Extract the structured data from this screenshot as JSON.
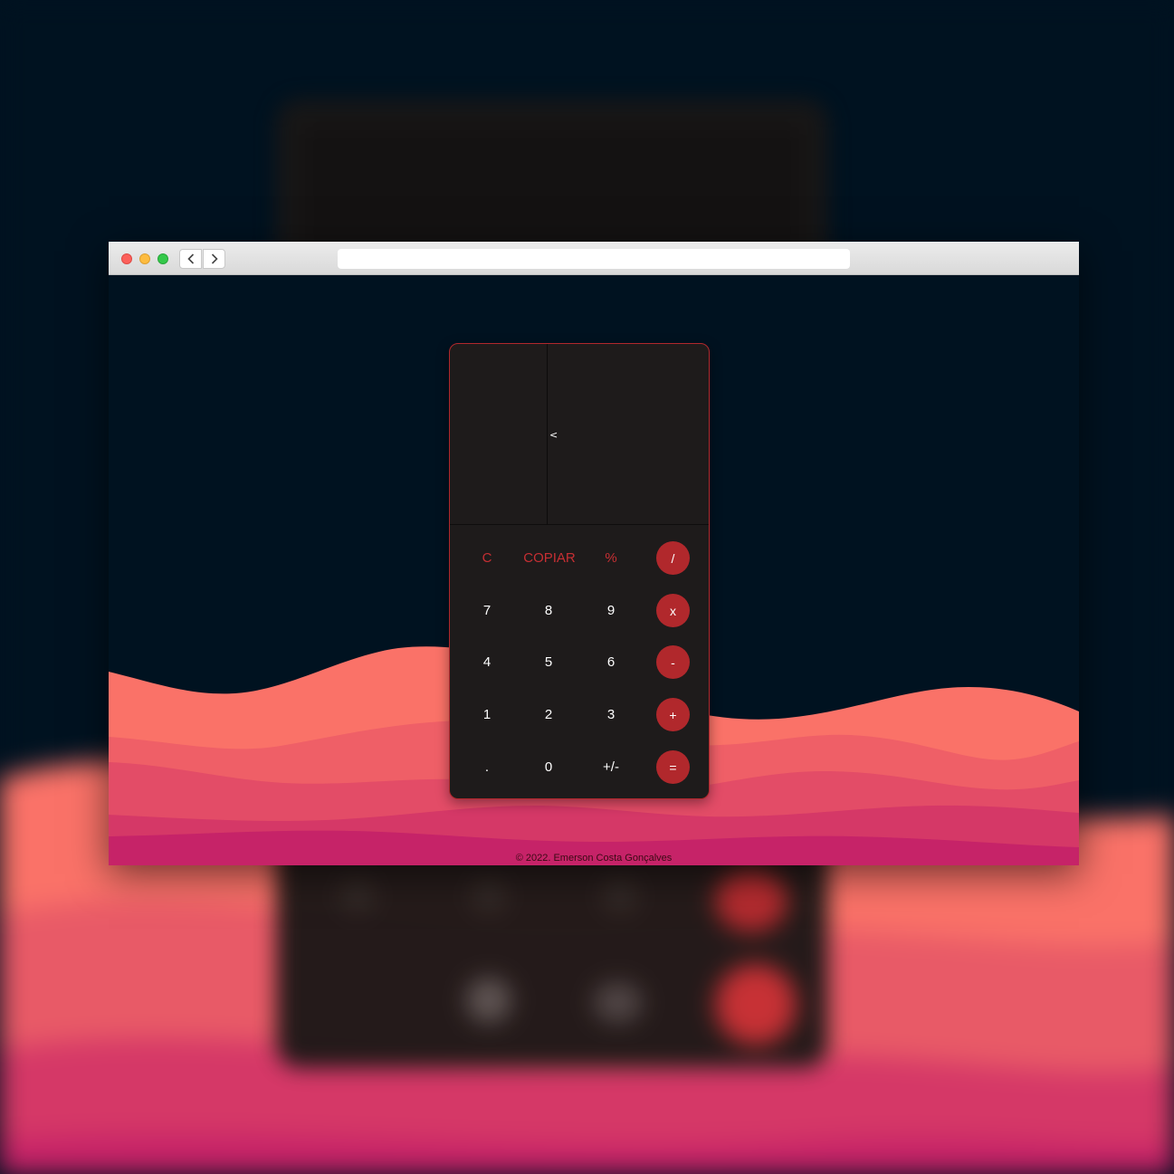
{
  "calculator": {
    "backspace_label": "<",
    "display_value": "",
    "keys": {
      "clear": "C",
      "copy": "COPIAR",
      "percent": "%",
      "divide": "/",
      "seven": "7",
      "eight": "8",
      "nine": "9",
      "multiply": "x",
      "four": "4",
      "five": "5",
      "six": "6",
      "subtract": "-",
      "one": "1",
      "two": "2",
      "three": "3",
      "add": "+",
      "decimal": ".",
      "zero": "0",
      "negate": "+/-",
      "equals": "="
    }
  },
  "footer": {
    "text": "© 2022. Emerson Costa Gonçalves"
  },
  "colors": {
    "background": "#001220",
    "accent": "#b1282c",
    "calculator_body": "#1e1b1b",
    "wave_1": "#fa7268",
    "wave_2": "#ef5f67",
    "wave_3": "#e34c67",
    "wave_4": "#d53867",
    "wave_5": "#c62368"
  },
  "icons": {
    "back": "chevron-left-icon",
    "forward": "chevron-right-icon"
  }
}
